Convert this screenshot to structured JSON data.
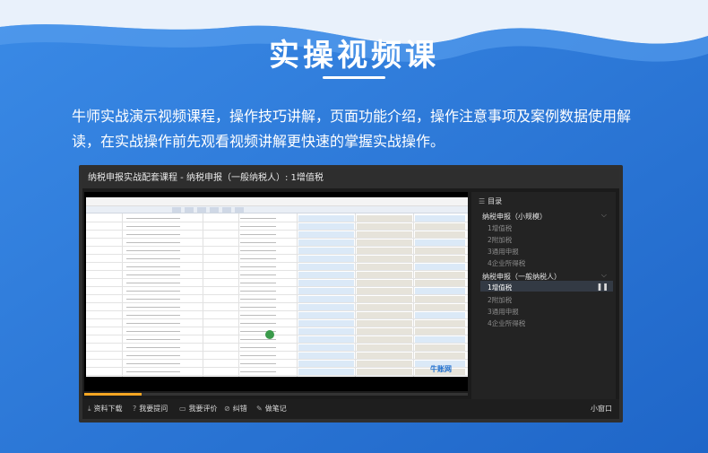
{
  "header": {
    "title": "实操视频课",
    "description": "牛师实战演示视频课程，操作技巧讲解，页面功能介绍，操作注意事项及案例数据使用解读，在实战操作前先观看视频讲解更快速的掌握实战操作。"
  },
  "player": {
    "window_title": "纳税申报实战配套课程 - 纳税申报（一般纳税人）: 1增值税",
    "progress_fraction": 0.15,
    "sheet_logo": "牛账网",
    "toolbar": {
      "download": "资料下载",
      "ask": "我要提问",
      "review": "我要评价",
      "error": "纠错",
      "note": "做笔记",
      "mini_window": "小窗口"
    },
    "icons": {
      "download": "download-icon",
      "ask": "question-icon",
      "review": "comment-icon",
      "error": "error-icon",
      "note": "edit-icon",
      "catalog": "list-icon"
    },
    "sidebar": {
      "heading": "目录",
      "sections": [
        {
          "title": "纳税申报（小规模）",
          "items": [
            "1增值税",
            "2附加税",
            "3通用申报",
            "4企业所得税"
          ]
        },
        {
          "title": "纳税申报（一般纳税人）",
          "items": [
            "1增值税",
            "2附加税",
            "3通用申报",
            "4企业所得税"
          ]
        }
      ],
      "active_item": "1增值税"
    }
  },
  "colors": {
    "background": "#2a78d8",
    "player_bg": "#1b1b1b",
    "accent": "#f5a623"
  }
}
